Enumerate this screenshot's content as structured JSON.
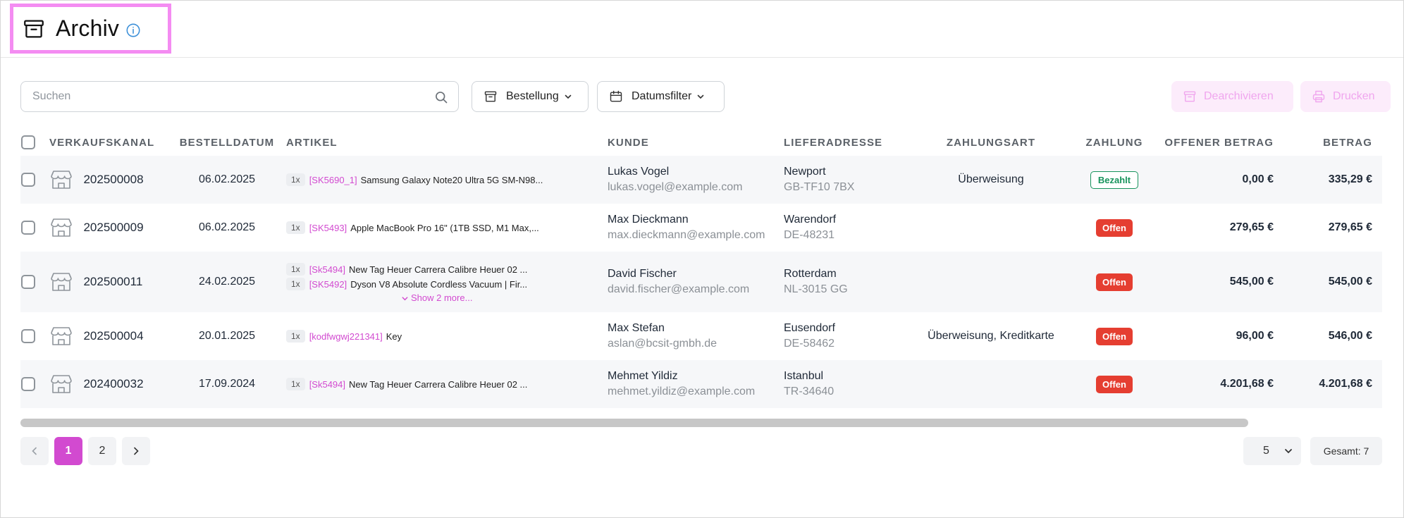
{
  "header": {
    "title": "Archiv"
  },
  "toolbar": {
    "search_placeholder": "Suchen",
    "order_label": "Bestellung",
    "date_filter_label": "Datumsfilter",
    "unarchive_label": "Dearchivieren",
    "print_label": "Drucken"
  },
  "table": {
    "headers": [
      "VERKAUFSKANAL",
      "BESTELLDATUM",
      "ARTIKEL",
      "KUNDE",
      "LIEFERADRESSE",
      "ZAHLUNGSART",
      "ZAHLUNG",
      "OFFENER BETRAG",
      "BETRAG"
    ],
    "rows": [
      {
        "order_no": "202500008",
        "date": "06.02.2025",
        "items": [
          {
            "qty": "1x",
            "sku": "[SK5690_1]",
            "name": "Samsung Galaxy Note20 Ultra 5G SM-N98..."
          }
        ],
        "more": "",
        "customer_name": "Lukas Vogel",
        "customer_email": "lukas.vogel@example.com",
        "city": "Newport",
        "zip": "GB-TF10 7BX",
        "payment_method": "Überweisung",
        "status": "Bezahlt",
        "status_type": "paid",
        "open_amount": "0,00 €",
        "amount": "335,29 €"
      },
      {
        "order_no": "202500009",
        "date": "06.02.2025",
        "items": [
          {
            "qty": "1x",
            "sku": "[SK5493]",
            "name": "Apple MacBook Pro 16\" (1TB SSD, M1 Max,..."
          }
        ],
        "more": "",
        "customer_name": "Max Dieckmann",
        "customer_email": "max.dieckmann@example.com",
        "city": "Warendorf",
        "zip": "DE-48231",
        "payment_method": "",
        "status": "Offen",
        "status_type": "open",
        "open_amount": "279,65 €",
        "amount": "279,65 €"
      },
      {
        "order_no": "202500011",
        "date": "24.02.2025",
        "items": [
          {
            "qty": "1x",
            "sku": "[Sk5494]",
            "name": "New Tag Heuer Carrera Calibre Heuer 02 ..."
          },
          {
            "qty": "1x",
            "sku": "[SK5492]",
            "name": "Dyson V8 Absolute Cordless Vacuum | Fir..."
          }
        ],
        "more": "Show 2 more...",
        "customer_name": "David Fischer",
        "customer_email": "david.fischer@example.com",
        "city": "Rotterdam",
        "zip": "NL-3015 GG",
        "payment_method": "",
        "status": "Offen",
        "status_type": "open",
        "open_amount": "545,00 €",
        "amount": "545,00 €"
      },
      {
        "order_no": "202500004",
        "date": "20.01.2025",
        "items": [
          {
            "qty": "1x",
            "sku": "[kodfwgwj221341]",
            "name": "Key"
          }
        ],
        "more": "",
        "customer_name": "Max Stefan",
        "customer_email": "aslan@bcsit-gmbh.de",
        "city": "Eusendorf",
        "zip": "DE-58462",
        "payment_method": "Überweisung, Kreditkarte",
        "status": "Offen",
        "status_type": "open",
        "open_amount": "96,00 €",
        "amount": "546,00 €"
      },
      {
        "order_no": "202400032",
        "date": "17.09.2024",
        "items": [
          {
            "qty": "1x",
            "sku": "[Sk5494]",
            "name": "New Tag Heuer Carrera Calibre Heuer 02 ..."
          }
        ],
        "more": "",
        "customer_name": "Mehmet Yildiz",
        "customer_email": "mehmet.yildiz@example.com",
        "city": "Istanbul",
        "zip": "TR-34640",
        "payment_method": "",
        "status": "Offen",
        "status_type": "open",
        "open_amount": "4.201,68 €",
        "amount": "4.201,68 €"
      }
    ]
  },
  "pagination": {
    "pages": [
      "1",
      "2"
    ],
    "current": "1",
    "page_size": "5",
    "total": "Gesamt: 7"
  },
  "colors": {
    "accent": "#d24ad0",
    "highlight_border": "#f48cf2",
    "paid": "#17935c",
    "open": "#e53e31",
    "disabled_bg": "#fcecfb"
  }
}
